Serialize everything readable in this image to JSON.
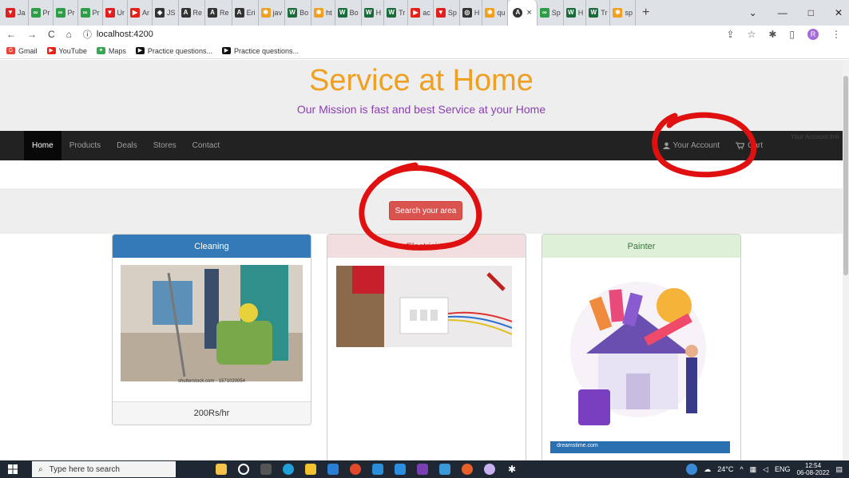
{
  "browser": {
    "tabs": [
      {
        "label": "Ja",
        "color": "#e0201f",
        "glyph": "▼"
      },
      {
        "label": "Pr",
        "color": "#2e9d48",
        "glyph": "∞"
      },
      {
        "label": "Pr",
        "color": "#2e9d48",
        "glyph": "∞"
      },
      {
        "label": "Pr",
        "color": "#2e9d48",
        "glyph": "∞"
      },
      {
        "label": "Ur",
        "color": "#e0201f",
        "glyph": "▼"
      },
      {
        "label": "Ar",
        "color": "#e62117",
        "glyph": "▶"
      },
      {
        "label": "JS",
        "color": "#333333",
        "glyph": "◆"
      },
      {
        "label": "Re",
        "color": "#333333",
        "glyph": "A"
      },
      {
        "label": "Re",
        "color": "#333333",
        "glyph": "A"
      },
      {
        "label": "Eri",
        "color": "#333333",
        "glyph": "A"
      },
      {
        "label": "jav",
        "color": "#f0a020",
        "glyph": "✱"
      },
      {
        "label": "Bo",
        "color": "#1a6b3a",
        "glyph": "W"
      },
      {
        "label": "ht",
        "color": "#f0a020",
        "glyph": "✱"
      },
      {
        "label": "Bo",
        "color": "#1a6b3a",
        "glyph": "W"
      },
      {
        "label": "H",
        "color": "#1a6b3a",
        "glyph": "W"
      },
      {
        "label": "Tr",
        "color": "#1a6b3a",
        "glyph": "W"
      },
      {
        "label": "ac",
        "color": "#e62117",
        "glyph": "▶"
      },
      {
        "label": "Sp",
        "color": "#e0201f",
        "glyph": "▼"
      },
      {
        "label": "H",
        "color": "#333333",
        "glyph": "◎"
      },
      {
        "label": "qu",
        "color": "#f0a020",
        "glyph": "✱"
      }
    ],
    "active_tab": {
      "color": "#333333",
      "glyph": "A",
      "close": "×"
    },
    "tabs_after": [
      {
        "label": "Sp",
        "color": "#2e9d48",
        "glyph": "∞"
      },
      {
        "label": "H",
        "color": "#1a6b3a",
        "glyph": "W"
      },
      {
        "label": "Tr",
        "color": "#1a6b3a",
        "glyph": "W"
      },
      {
        "label": "sp",
        "color": "#f0a020",
        "glyph": "✱"
      }
    ],
    "new_tab": "+",
    "window_controls": {
      "menu": "⌄",
      "minimize": "—",
      "maximize": "□",
      "close": "✕"
    },
    "nav": {
      "back": "←",
      "forward": "→",
      "reload": "C",
      "home": "⌂"
    },
    "url": "localhost:4200",
    "info_icon": "ⓘ",
    "toolbar_icons": {
      "share": "⇪",
      "star": "☆",
      "extensions": "✱",
      "sidepanel": "▯",
      "profile": "R",
      "menu": "⋮"
    },
    "bookmarks": [
      {
        "label": "Gmail",
        "color": "#ea4335",
        "glyph": "G"
      },
      {
        "label": "YouTube",
        "color": "#e62117",
        "glyph": "▶"
      },
      {
        "label": "Maps",
        "color": "#34a853",
        "glyph": "✦"
      },
      {
        "label": "Practice questions...",
        "color": "#111111",
        "glyph": "▶"
      },
      {
        "label": "Practice questions...",
        "color": "#111111",
        "glyph": "▶"
      }
    ]
  },
  "site": {
    "title": "Service at Home",
    "mission": "Our Mission is fast and best Service at your Home",
    "nav": {
      "home": "Home",
      "products": "Products",
      "deals": "Deals",
      "stores": "Stores",
      "contact": "Contact",
      "account": "Your Account",
      "cart": "Cart",
      "faint": "Your Account link"
    },
    "search_button": "Search your area",
    "cards": [
      {
        "title": "Cleaning",
        "head_bg": "#337ab7",
        "head_color": "#ffffff",
        "watermark": "shutterstock.com · 1571020054",
        "price": "200Rs/hr"
      },
      {
        "title": "Electrician",
        "head_bg": "#f2dede",
        "head_color": "#a94442"
      },
      {
        "title": "Painter",
        "head_bg": "#dff0d8",
        "head_color": "#3c763d",
        "watermark": "dreamstime.com"
      }
    ]
  },
  "taskbar": {
    "search_placeholder": "Type here to search",
    "weather": "24°C",
    "lang": "ENG",
    "time": "12:54",
    "date": "06-08-2022"
  }
}
